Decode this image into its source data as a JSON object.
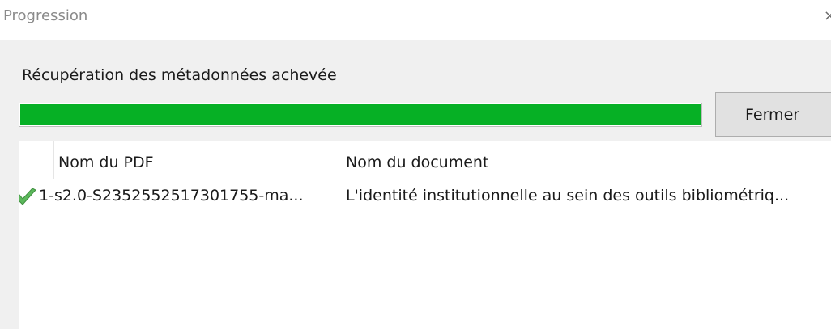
{
  "window": {
    "title": "Progression",
    "close_glyph": "×"
  },
  "status": {
    "text": "Récupération des métadonnées achevée"
  },
  "progress": {
    "value_percent": 100,
    "color": "#06b025"
  },
  "buttons": {
    "close_label": "Fermer"
  },
  "table": {
    "columns": [
      "Nom du PDF",
      "Nom du document"
    ],
    "rows": [
      {
        "status_icon": "checkmark-icon",
        "pdf_name": "1-s2.0-S2352552517301755-ma...",
        "document_name": "L'identité institutionnelle au sein des outils bibliométriq..."
      }
    ]
  }
}
